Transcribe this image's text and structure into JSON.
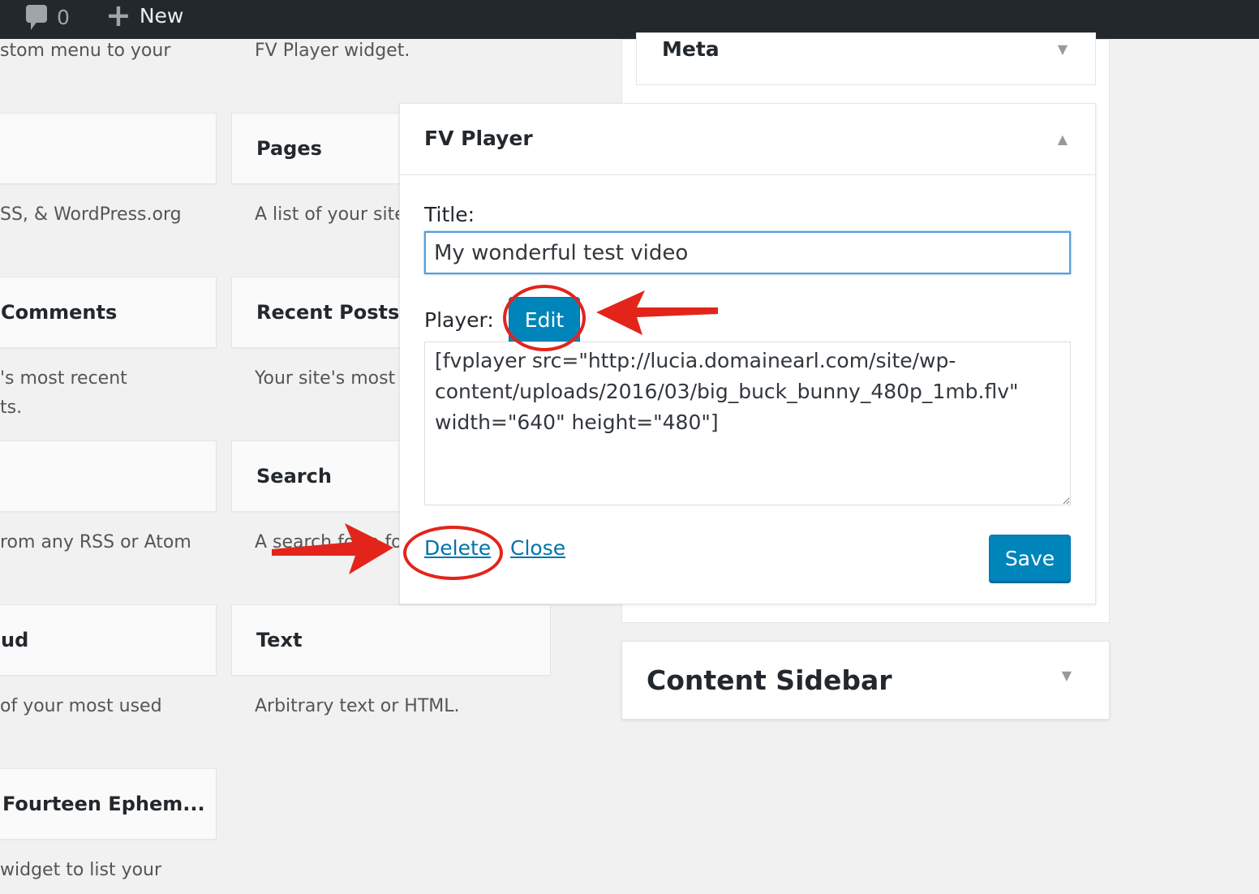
{
  "admin_bar": {
    "comments_count": "0",
    "new_label": "New"
  },
  "available_widgets": {
    "col1": [
      {
        "desc": "stom menu to your"
      },
      {
        "title": "",
        "desc": "SS, & WordPress.org"
      },
      {
        "title": "Comments",
        "desc": "'s most recent",
        "desc2": "ts."
      },
      {
        "title": "",
        "desc": "rom any RSS or Atom"
      },
      {
        "title": "ud",
        "desc": "of your most used"
      },
      {
        "title": "Fourteen Ephem...",
        "desc": "widget to list your"
      }
    ],
    "col2": [
      {
        "desc": "FV Player widget."
      },
      {
        "title": "Pages",
        "desc": "A list of your site"
      },
      {
        "title": "Recent Posts",
        "desc": "Your site's most"
      },
      {
        "title": "Search",
        "desc": "A search form fo"
      },
      {
        "title": "Text",
        "desc": "Arbitrary text or HTML."
      }
    ]
  },
  "sidebar": {
    "meta_title": "Meta",
    "content_sidebar_title": "Content Sidebar"
  },
  "fv_widget": {
    "title": "FV Player",
    "title_label": "Title:",
    "title_value": "My wonderful test video",
    "player_label": "Player:",
    "edit_label": "Edit",
    "shortcode": "[fvplayer src=\"http://lucia.domainearl.com/site/wp-content/uploads/2016/03/big_buck_bunny_480p_1mb.flv\" width=\"640\" height=\"480\"]",
    "delete_label": "Delete",
    "close_label": "Close",
    "save_label": "Save"
  },
  "colors": {
    "accent": "#0085ba",
    "annotation": "#e3241b",
    "admin_bar": "#23282d"
  }
}
